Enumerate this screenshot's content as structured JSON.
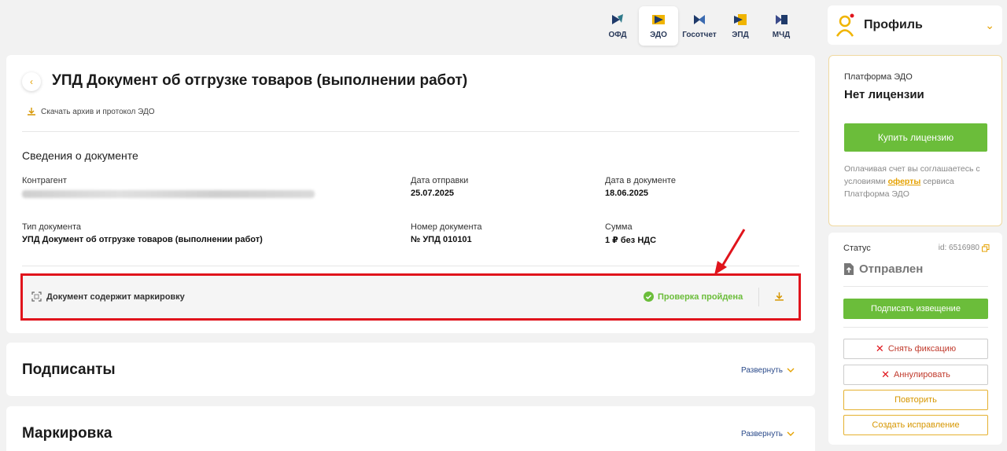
{
  "nav": [
    {
      "label": "ОФД",
      "icon": "ofd-icon",
      "active": false
    },
    {
      "label": "ЭДО",
      "icon": "edo-icon",
      "active": true
    },
    {
      "label": "Госотчет",
      "icon": "gosotchet-icon",
      "active": false
    },
    {
      "label": "ЭПД",
      "icon": "epd-icon",
      "active": false
    },
    {
      "label": "МЧД",
      "icon": "mchd-icon",
      "active": false
    }
  ],
  "profile": {
    "name": "Профиль"
  },
  "doc": {
    "title": "УПД Документ об отгрузке товаров (выполнении работ)",
    "download_link": "Скачать архив и протокол ЭДО",
    "section_title": "Сведения о документе",
    "fields": {
      "counterparty_label": "Контрагент",
      "sent_date_label": "Дата отправки",
      "sent_date": "25.07.2025",
      "doc_date_label": "Дата в документе",
      "doc_date": "18.06.2025",
      "type_label": "Тип документа",
      "type": "УПД Документ об отгрузке товаров (выполнении работ)",
      "number_label": "Номер документа",
      "number": "№ УПД 010101",
      "sum_label": "Сумма",
      "sum": "1 ₽ без НДС"
    },
    "marking": {
      "label": "Документ содержит маркировку",
      "status": "Проверка пройдена"
    }
  },
  "sections": [
    {
      "title": "Подписанты",
      "expand": "Развернуть"
    },
    {
      "title": "Маркировка",
      "expand": "Развернуть"
    }
  ],
  "license": {
    "platform": "Платформа ЭДО",
    "state": "Нет лицензии",
    "buy": "Купить лицензию",
    "note_before": "Оплачивая счет вы соглашаетесь с условиями",
    "note_link": "оферты",
    "note_after": "сервиса Платформа ЭДО"
  },
  "status": {
    "label": "Статус",
    "id": "id: 6516980",
    "state": "Отправлен",
    "sign_notice": "Подписать извещение",
    "unfix": "Снять фиксацию",
    "annul": "Аннулировать",
    "repeat": "Повторить",
    "create_fix": "Создать исправление"
  },
  "colors": {
    "accent": "#e5a100",
    "green": "#6bbd3a",
    "highlight": "#e0141c"
  }
}
